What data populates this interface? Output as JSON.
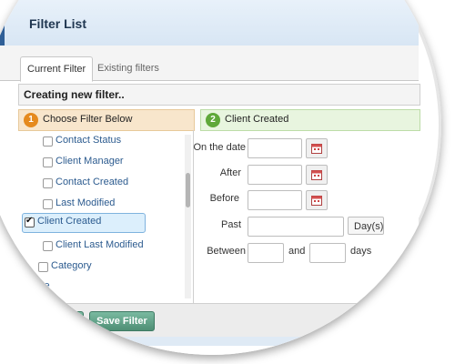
{
  "window": {
    "title": "Filter List"
  },
  "tabs": [
    {
      "label": "Current Filter",
      "active": true
    },
    {
      "label": "Existing filters",
      "active": false
    }
  ],
  "filter_name": "Creating new filter..",
  "left_panel": {
    "step": "1",
    "header": "Choose Filter Below",
    "items": [
      {
        "label": "Contact Status",
        "checked": false
      },
      {
        "label": "Client Manager",
        "checked": false
      },
      {
        "label": "Contact Created",
        "checked": false
      },
      {
        "label": "Last Modified",
        "checked": false
      },
      {
        "label": "Client Created",
        "checked": true
      },
      {
        "label": "Client Last Modified",
        "checked": false
      },
      {
        "label": "Category",
        "checked": false
      },
      {
        "label": "ze",
        "checked": false
      }
    ]
  },
  "right_panel": {
    "step": "2",
    "header": "Client Created",
    "rows": {
      "on_the_date": "On the date",
      "after": "After",
      "before": "Before",
      "past": "Past",
      "between": "Between"
    },
    "past_unit": "Day(s)",
    "between_and": "and",
    "between_unit": "days"
  },
  "footer": {
    "save_filter": "Save Filter"
  },
  "colors": {
    "title_accent": "#2f5f97",
    "step1": "#e58a1e",
    "step2": "#5fa83a",
    "link": "#2c5b8f",
    "button": "#4f8f75"
  }
}
